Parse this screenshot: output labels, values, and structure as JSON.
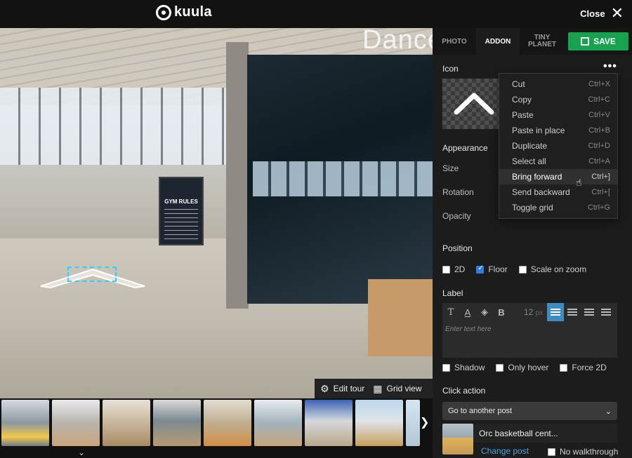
{
  "topbar": {
    "logo_text": "kuula",
    "close_label": "Close",
    "close_icon": "close-icon"
  },
  "viewer": {
    "scene_sign_title": "GYM RULES",
    "scene_text": "Dance",
    "tools": [
      {
        "label": "Edit tour",
        "icon": "gear-icon"
      },
      {
        "label": "Grid view",
        "icon": "grid-icon"
      }
    ],
    "thumbnails": 9,
    "next_icon": "chevron-right-icon",
    "collapse_icon": "chevron-down-icon"
  },
  "panel": {
    "tabs": [
      {
        "label": "PHOTO",
        "active": false
      },
      {
        "label": "ADDON",
        "active": true
      },
      {
        "label": "TINY PLANET",
        "active": false
      }
    ],
    "save_label": "SAVE",
    "icon_title": "Icon",
    "more_icon": "more-dots-icon",
    "appearance_title": "Appearance",
    "appearance_rows": [
      "Size",
      "Rotation",
      "Opacity"
    ],
    "position_title": "Position",
    "position_options": [
      {
        "label": "2D",
        "checked": false
      },
      {
        "label": "Floor",
        "checked": true
      },
      {
        "label": "Scale on zoom",
        "checked": false
      }
    ],
    "label_title": "Label",
    "label_font_size": "12",
    "label_font_unit": "px",
    "label_placeholder": "Enter text here",
    "label_options": [
      {
        "label": "Shadow",
        "checked": false
      },
      {
        "label": "Only hover",
        "checked": false
      },
      {
        "label": "Force 2D",
        "checked": false
      }
    ],
    "click_action_title": "Click action",
    "click_action_value": "Go to another post",
    "post_name": "Orc basketball cent...",
    "change_post": "Change post",
    "no_walkthrough": "No walkthrough"
  },
  "context_menu": {
    "items": [
      {
        "label": "Cut",
        "shortcut": "Ctrl+X"
      },
      {
        "label": "Copy",
        "shortcut": "Ctrl+C"
      },
      {
        "label": "Paste",
        "shortcut": "Ctrl+V"
      },
      {
        "label": "Paste in place",
        "shortcut": "Ctrl+B"
      },
      {
        "label": "Duplicate",
        "shortcut": "Ctrl+D"
      },
      {
        "label": "Select all",
        "shortcut": "Ctrl+A"
      },
      {
        "label": "Bring forward",
        "shortcut": "Ctrl+]"
      },
      {
        "label": "Send backward",
        "shortcut": "Ctrl+["
      },
      {
        "label": "Toggle grid",
        "shortcut": "Ctrl+G"
      }
    ],
    "hovered": "Bring forward"
  },
  "colors": {
    "accent": "#17a24f",
    "highlight": "#3f8cc0",
    "link": "#4fa3e0",
    "hotspot_frame": "#2fd0ff"
  }
}
